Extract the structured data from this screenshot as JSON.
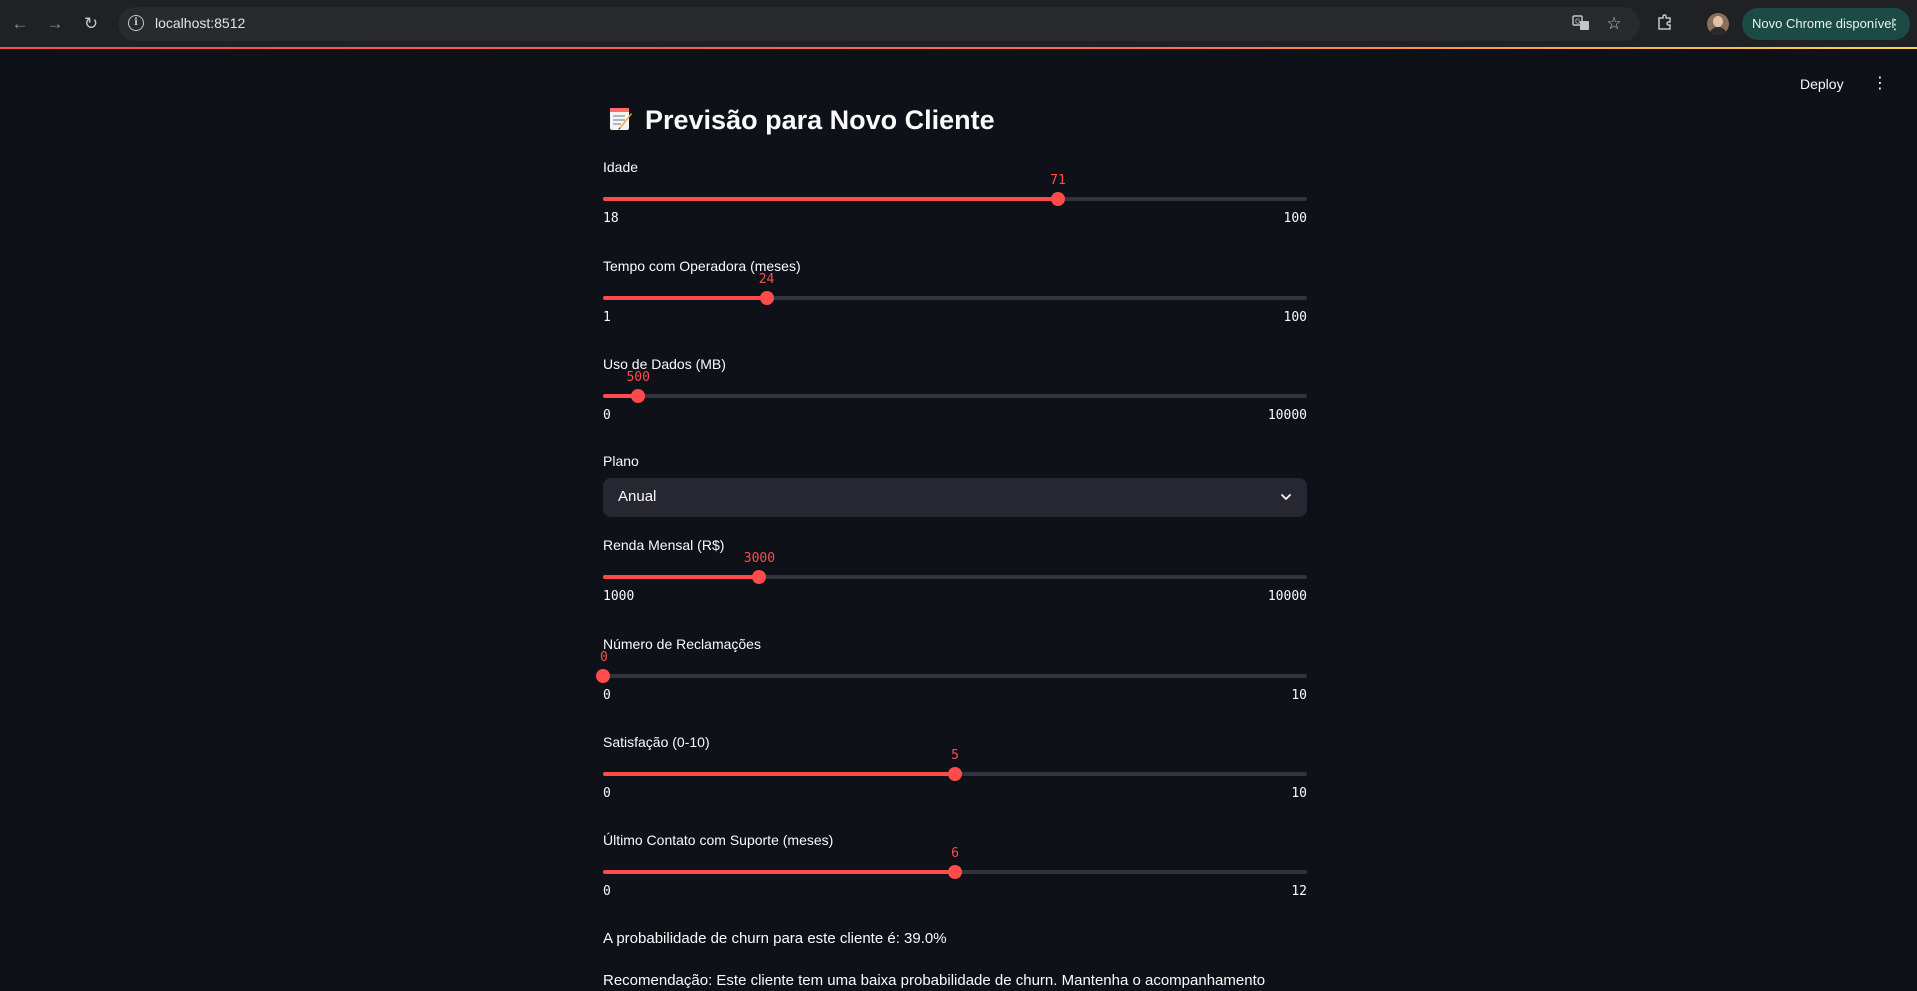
{
  "browser": {
    "url": "localhost:8512",
    "update_label": "Novo Chrome disponível"
  },
  "app_header": {
    "deploy_label": "Deploy"
  },
  "page": {
    "title": "Previsão para Novo Cliente",
    "title_icon": "memo-emoji-icon"
  },
  "sliders": [
    {
      "label": "Idade",
      "value": "71",
      "min": "18",
      "max": "100",
      "fraction": 0.6463
    },
    {
      "label": "Tempo com Operadora (meses)",
      "value": "24",
      "min": "1",
      "max": "100",
      "fraction": 0.2323
    },
    {
      "label": "Uso de Dados (MB)",
      "value": "500",
      "min": "0",
      "max": "10000",
      "fraction": 0.05
    },
    {
      "label": "Renda Mensal (R$)",
      "value": "3000",
      "min": "1000",
      "max": "10000",
      "fraction": 0.2222
    },
    {
      "label": "Número de Reclamações",
      "value": "0",
      "min": "0",
      "max": "10",
      "fraction": 0.0
    },
    {
      "label": "Satisfação (0-10)",
      "value": "5",
      "min": "0",
      "max": "10",
      "fraction": 0.5
    },
    {
      "label": "Último Contato com Suporte (meses)",
      "value": "6",
      "min": "0",
      "max": "12",
      "fraction": 0.5
    }
  ],
  "plano": {
    "label": "Plano",
    "selected": "Anual"
  },
  "result": {
    "probability_text": "A probabilidade de churn para este cliente é: 39.0%",
    "recommendation_text": "Recomendação: Este cliente tem uma baixa probabilidade de churn. Mantenha o acompanhamento"
  },
  "colors": {
    "accent": "#ff4b4b",
    "background": "#0e1117",
    "track": "#31333f",
    "select_bg": "#262730"
  }
}
